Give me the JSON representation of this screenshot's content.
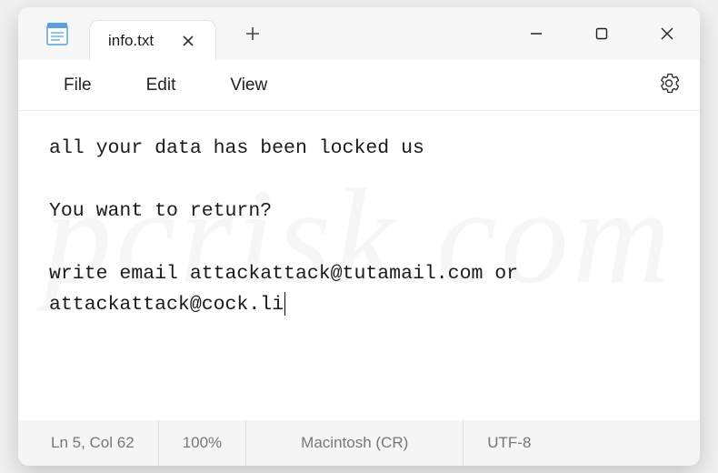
{
  "tab": {
    "title": "info.txt"
  },
  "menu": {
    "file": "File",
    "edit": "Edit",
    "view": "View"
  },
  "content": {
    "line1": "all your data has been locked us",
    "line2": "You want to return?",
    "line3": "write email attackattack@tutamail.com or attackattack@cock.li"
  },
  "status": {
    "position": "Ln 5, Col 62",
    "zoom": "100%",
    "eol": "Macintosh (CR)",
    "encoding": "UTF-8"
  },
  "watermark": "pcrisk.com"
}
